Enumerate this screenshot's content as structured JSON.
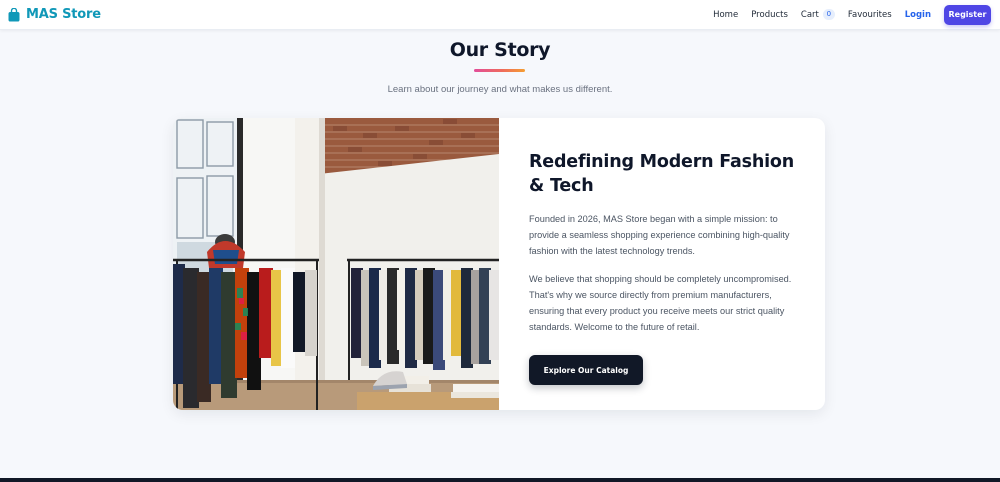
{
  "brand": {
    "name": "MAS Store",
    "icon": "shopping-bag-icon",
    "color": "#1098b8"
  },
  "nav": {
    "home": "Home",
    "products": "Products",
    "cart": "Cart",
    "cart_count": "0",
    "favourites": "Favourites",
    "login": "Login",
    "register": "Register"
  },
  "page": {
    "title": "Our Story",
    "subtitle": "Learn about our journey and what makes us different."
  },
  "story": {
    "heading": "Redefining Modern Fashion & Tech",
    "paragraph_1": "Founded in 2026, MAS Store began with a simple mission: to provide a seamless shopping experience combining high-quality fashion with the latest technology trends.",
    "paragraph_2": "We believe that shopping should be completely uncompromised. That's why we source directly from premium manufacturers, ensuring that every product you receive meets our strict quality standards. Welcome to the future of retail.",
    "button": "Explore Our Catalog"
  },
  "colors": {
    "accent": "#4f46e5",
    "link": "#2563eb",
    "dark": "#111827",
    "underline_gradient": [
      "#e24d9a",
      "#ef6b5c",
      "#f59e32"
    ]
  }
}
